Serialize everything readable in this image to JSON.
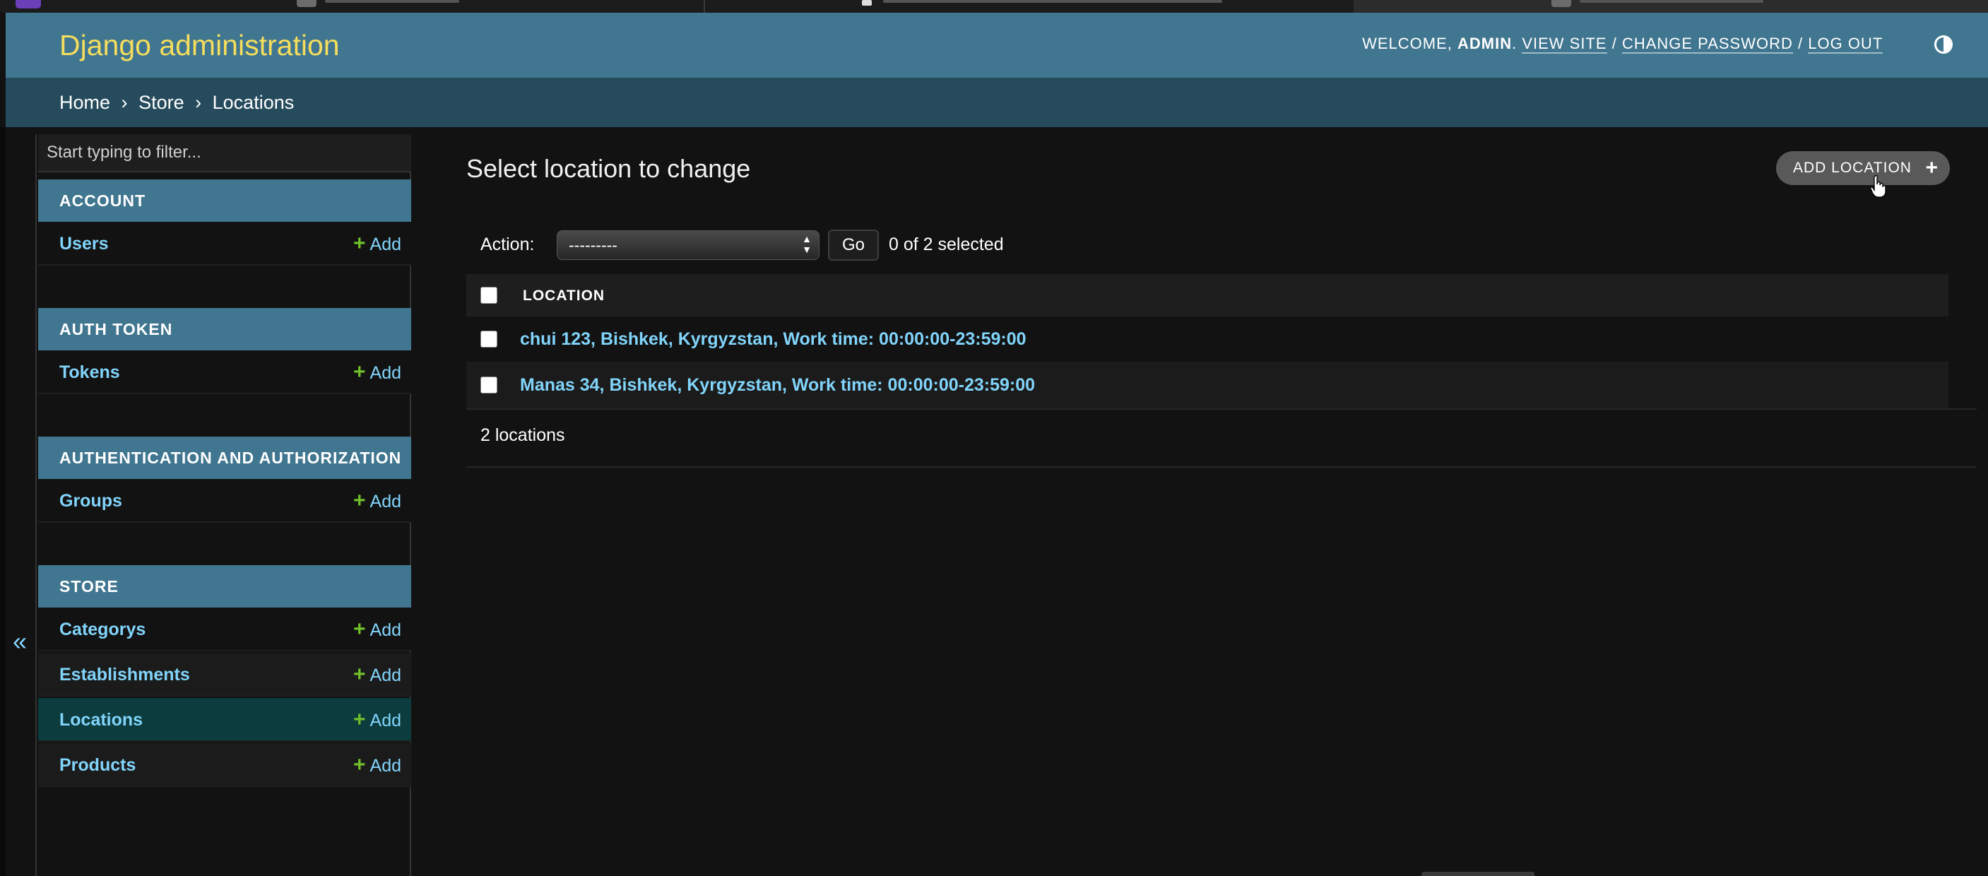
{
  "header": {
    "brand": "Django administration",
    "welcome": "Welcome,",
    "username": "admin",
    "view_site": "View site",
    "change_password": "Change password",
    "log_out": "Log out",
    "theme_icon": "half-circle-contrast-icon"
  },
  "breadcrumbs": {
    "home": "Home",
    "store": "Store",
    "current": "Locations",
    "separator": "›"
  },
  "sidebar": {
    "filter_placeholder": "Start typing to filter...",
    "add_label": "Add",
    "collapse_icon": "«",
    "modules": [
      {
        "caption": "Account",
        "models": [
          {
            "name": "Users"
          }
        ]
      },
      {
        "caption": "Auth Token",
        "models": [
          {
            "name": "Tokens"
          }
        ]
      },
      {
        "caption": "Authentication and Authorization",
        "models": [
          {
            "name": "Groups"
          }
        ]
      },
      {
        "caption": "Store",
        "models": [
          {
            "name": "Categorys"
          },
          {
            "name": "Establishments"
          },
          {
            "name": "Locations",
            "current": true
          },
          {
            "name": "Products"
          }
        ]
      }
    ]
  },
  "content": {
    "title": "Select location to change",
    "add_button": "Add location",
    "action_label": "Action:",
    "action_value": "---------",
    "go_label": "Go",
    "selected_count": "0 of 2 selected",
    "column_header": "Location",
    "rows": [
      "chui 123, Bishkek, Kyrgyzstan, Work time: 00:00:00-23:59:00",
      "Manas 34, Bishkek, Kyrgyzstan, Work time: 00:00:00-23:59:00"
    ],
    "paginator": "2 locations"
  },
  "colors": {
    "header_bg": "#417690",
    "breadcrumb_bg": "#264b5d",
    "brand": "#f5dd5d",
    "link": "#81d4fa",
    "add_green": "#70bf2b",
    "current_row": "#0c3c3e"
  }
}
